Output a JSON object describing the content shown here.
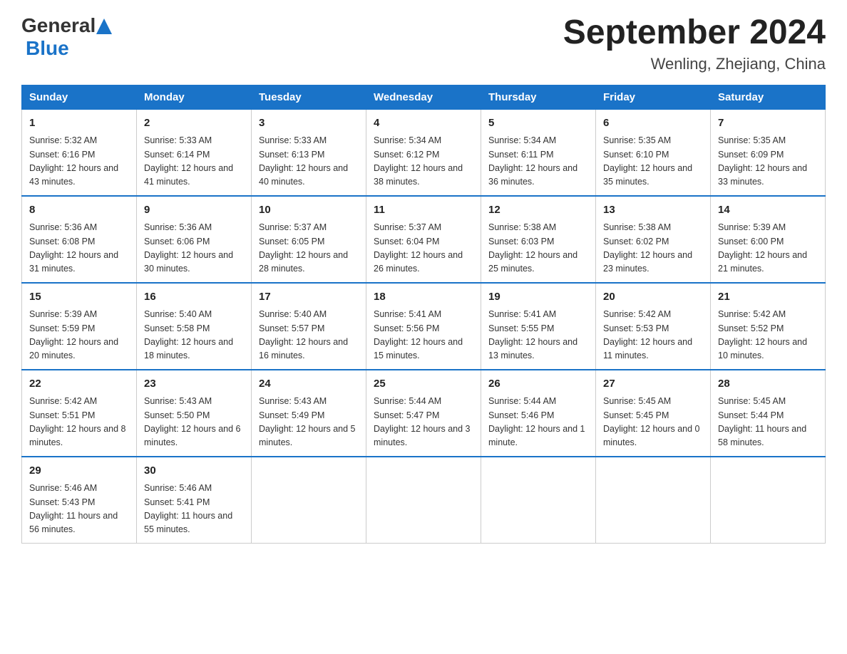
{
  "header": {
    "logo_general": "General",
    "logo_blue": "Blue",
    "title": "September 2024",
    "subtitle": "Wenling, Zhejiang, China"
  },
  "days_of_week": [
    "Sunday",
    "Monday",
    "Tuesday",
    "Wednesday",
    "Thursday",
    "Friday",
    "Saturday"
  ],
  "weeks": [
    [
      {
        "day": "1",
        "sunrise": "Sunrise: 5:32 AM",
        "sunset": "Sunset: 6:16 PM",
        "daylight": "Daylight: 12 hours and 43 minutes."
      },
      {
        "day": "2",
        "sunrise": "Sunrise: 5:33 AM",
        "sunset": "Sunset: 6:14 PM",
        "daylight": "Daylight: 12 hours and 41 minutes."
      },
      {
        "day": "3",
        "sunrise": "Sunrise: 5:33 AM",
        "sunset": "Sunset: 6:13 PM",
        "daylight": "Daylight: 12 hours and 40 minutes."
      },
      {
        "day": "4",
        "sunrise": "Sunrise: 5:34 AM",
        "sunset": "Sunset: 6:12 PM",
        "daylight": "Daylight: 12 hours and 38 minutes."
      },
      {
        "day": "5",
        "sunrise": "Sunrise: 5:34 AM",
        "sunset": "Sunset: 6:11 PM",
        "daylight": "Daylight: 12 hours and 36 minutes."
      },
      {
        "day": "6",
        "sunrise": "Sunrise: 5:35 AM",
        "sunset": "Sunset: 6:10 PM",
        "daylight": "Daylight: 12 hours and 35 minutes."
      },
      {
        "day": "7",
        "sunrise": "Sunrise: 5:35 AM",
        "sunset": "Sunset: 6:09 PM",
        "daylight": "Daylight: 12 hours and 33 minutes."
      }
    ],
    [
      {
        "day": "8",
        "sunrise": "Sunrise: 5:36 AM",
        "sunset": "Sunset: 6:08 PM",
        "daylight": "Daylight: 12 hours and 31 minutes."
      },
      {
        "day": "9",
        "sunrise": "Sunrise: 5:36 AM",
        "sunset": "Sunset: 6:06 PM",
        "daylight": "Daylight: 12 hours and 30 minutes."
      },
      {
        "day": "10",
        "sunrise": "Sunrise: 5:37 AM",
        "sunset": "Sunset: 6:05 PM",
        "daylight": "Daylight: 12 hours and 28 minutes."
      },
      {
        "day": "11",
        "sunrise": "Sunrise: 5:37 AM",
        "sunset": "Sunset: 6:04 PM",
        "daylight": "Daylight: 12 hours and 26 minutes."
      },
      {
        "day": "12",
        "sunrise": "Sunrise: 5:38 AM",
        "sunset": "Sunset: 6:03 PM",
        "daylight": "Daylight: 12 hours and 25 minutes."
      },
      {
        "day": "13",
        "sunrise": "Sunrise: 5:38 AM",
        "sunset": "Sunset: 6:02 PM",
        "daylight": "Daylight: 12 hours and 23 minutes."
      },
      {
        "day": "14",
        "sunrise": "Sunrise: 5:39 AM",
        "sunset": "Sunset: 6:00 PM",
        "daylight": "Daylight: 12 hours and 21 minutes."
      }
    ],
    [
      {
        "day": "15",
        "sunrise": "Sunrise: 5:39 AM",
        "sunset": "Sunset: 5:59 PM",
        "daylight": "Daylight: 12 hours and 20 minutes."
      },
      {
        "day": "16",
        "sunrise": "Sunrise: 5:40 AM",
        "sunset": "Sunset: 5:58 PM",
        "daylight": "Daylight: 12 hours and 18 minutes."
      },
      {
        "day": "17",
        "sunrise": "Sunrise: 5:40 AM",
        "sunset": "Sunset: 5:57 PM",
        "daylight": "Daylight: 12 hours and 16 minutes."
      },
      {
        "day": "18",
        "sunrise": "Sunrise: 5:41 AM",
        "sunset": "Sunset: 5:56 PM",
        "daylight": "Daylight: 12 hours and 15 minutes."
      },
      {
        "day": "19",
        "sunrise": "Sunrise: 5:41 AM",
        "sunset": "Sunset: 5:55 PM",
        "daylight": "Daylight: 12 hours and 13 minutes."
      },
      {
        "day": "20",
        "sunrise": "Sunrise: 5:42 AM",
        "sunset": "Sunset: 5:53 PM",
        "daylight": "Daylight: 12 hours and 11 minutes."
      },
      {
        "day": "21",
        "sunrise": "Sunrise: 5:42 AM",
        "sunset": "Sunset: 5:52 PM",
        "daylight": "Daylight: 12 hours and 10 minutes."
      }
    ],
    [
      {
        "day": "22",
        "sunrise": "Sunrise: 5:42 AM",
        "sunset": "Sunset: 5:51 PM",
        "daylight": "Daylight: 12 hours and 8 minutes."
      },
      {
        "day": "23",
        "sunrise": "Sunrise: 5:43 AM",
        "sunset": "Sunset: 5:50 PM",
        "daylight": "Daylight: 12 hours and 6 minutes."
      },
      {
        "day": "24",
        "sunrise": "Sunrise: 5:43 AM",
        "sunset": "Sunset: 5:49 PM",
        "daylight": "Daylight: 12 hours and 5 minutes."
      },
      {
        "day": "25",
        "sunrise": "Sunrise: 5:44 AM",
        "sunset": "Sunset: 5:47 PM",
        "daylight": "Daylight: 12 hours and 3 minutes."
      },
      {
        "day": "26",
        "sunrise": "Sunrise: 5:44 AM",
        "sunset": "Sunset: 5:46 PM",
        "daylight": "Daylight: 12 hours and 1 minute."
      },
      {
        "day": "27",
        "sunrise": "Sunrise: 5:45 AM",
        "sunset": "Sunset: 5:45 PM",
        "daylight": "Daylight: 12 hours and 0 minutes."
      },
      {
        "day": "28",
        "sunrise": "Sunrise: 5:45 AM",
        "sunset": "Sunset: 5:44 PM",
        "daylight": "Daylight: 11 hours and 58 minutes."
      }
    ],
    [
      {
        "day": "29",
        "sunrise": "Sunrise: 5:46 AM",
        "sunset": "Sunset: 5:43 PM",
        "daylight": "Daylight: 11 hours and 56 minutes."
      },
      {
        "day": "30",
        "sunrise": "Sunrise: 5:46 AM",
        "sunset": "Sunset: 5:41 PM",
        "daylight": "Daylight: 11 hours and 55 minutes."
      },
      null,
      null,
      null,
      null,
      null
    ]
  ]
}
